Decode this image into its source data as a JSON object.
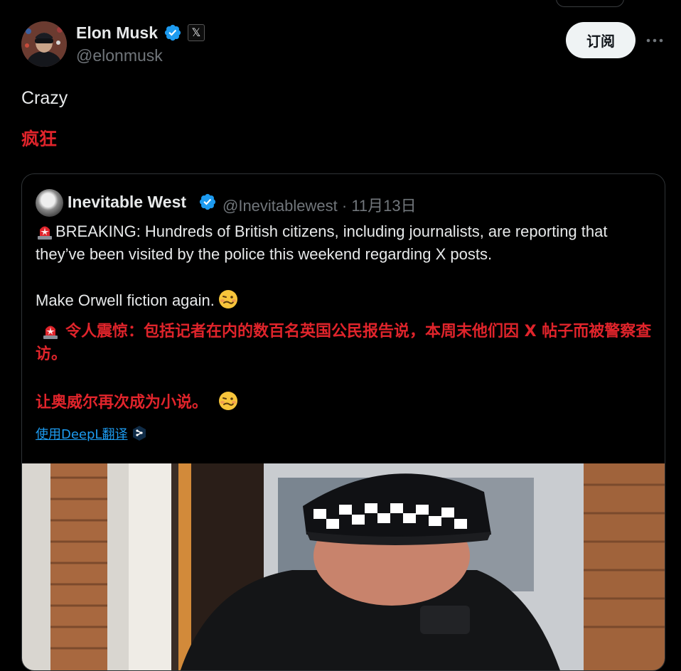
{
  "post": {
    "author_name": "Elon Musk",
    "handle": "@elonmusk",
    "x_badge": "𝕏",
    "subscribe_label": "订阅",
    "text": "Crazy",
    "translation": "疯狂"
  },
  "quote": {
    "author_name": "Inevitable West",
    "handle": "@Inevitablewest",
    "separator": " · ",
    "date": "11月13日",
    "body_line1": "BREAKING: Hundreds of British citizens, including journalists, are reporting that they’ve been visited by the police this weekend regarding X posts.",
    "body_line2": "Make Orwell fiction again.",
    "translation_line1": "令人震惊：包括记者在内的数百名英国公民报告说，本周末他们因 X 帖子而被警察查访。",
    "translation_line2": "让奥威尔再次成为小说。",
    "deepl_label": "使用DeepL翻译"
  },
  "icons": {
    "verified": "verified-badge-icon",
    "more": "more-icon",
    "siren": "police-light-emoji",
    "face": "woozy-face-emoji",
    "deepl": "deepl-logo-icon"
  },
  "colors": {
    "background": "#000000",
    "text": "#e7e9ea",
    "secondary": "#71767b",
    "accent": "#1d9bf0",
    "translation": "#e0242b"
  }
}
